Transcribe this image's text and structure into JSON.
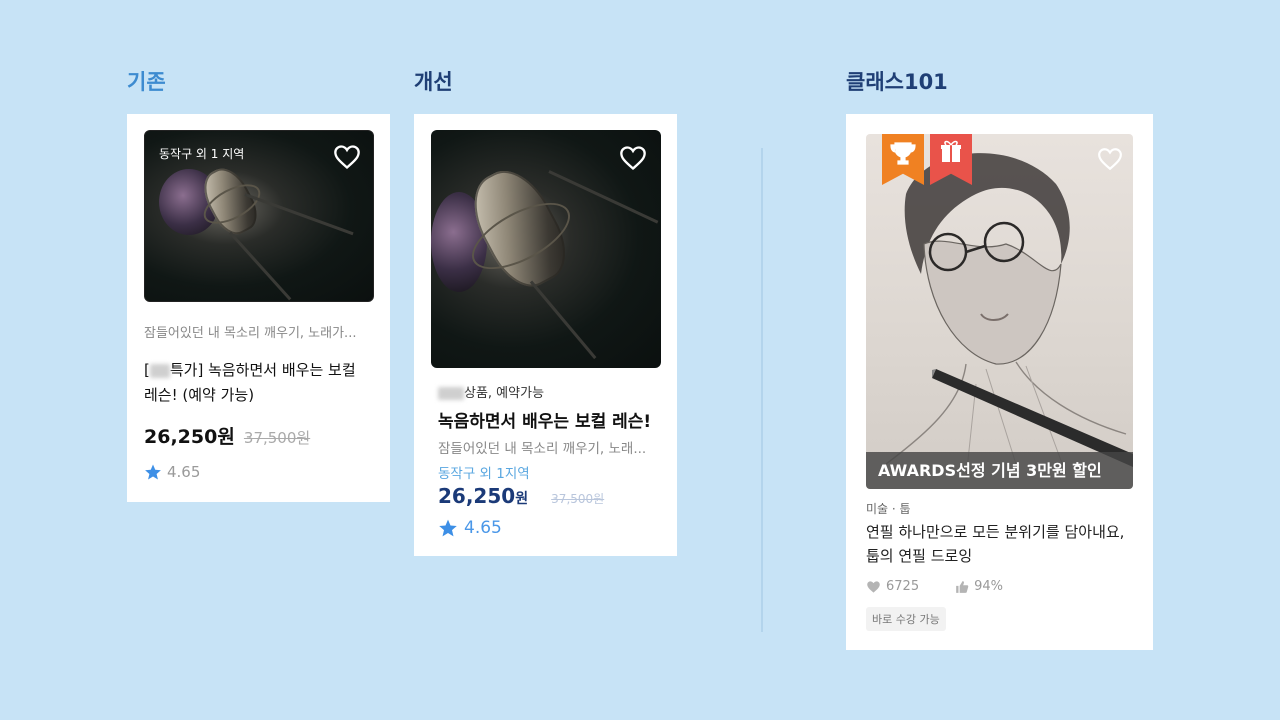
{
  "columns": {
    "before": {
      "title": "기존",
      "title_color": "#3d8bd0",
      "location_tag": "동작구 외 1 지역",
      "subtitle": "잠들어있던 내 목소리 깨우기, 노래가...",
      "title_prefix": "[",
      "title_suffix": "특가] 녹음하면서 배우는 보컬 레슨! (예약 가능)",
      "price": "26,250원",
      "original_price": "37,500원",
      "rating": "4.65",
      "icons": {
        "favorite": "heart-outline-icon",
        "rating": "star-icon"
      }
    },
    "after": {
      "title": "개선",
      "title_color": "#1f3f75",
      "category_suffix": "상품, 예약가능",
      "title_text": "녹음하면서 배우는 보컬 레슨!",
      "subtitle": "잠들어있던 내 목소리 깨우기, 노래...",
      "location": "동작구 외 1지역",
      "location_color": "#5aa7e0",
      "price": "26,250",
      "price_unit": "원",
      "price_color": "#1b3a78",
      "original_price": "37,500원",
      "rating": "4.65",
      "rating_color": "#4a97e8"
    },
    "class101": {
      "title": "클래스101",
      "title_color": "#1f3f75",
      "banner": "AWARDS선정 기념 3만원 할인",
      "category": "미술 · 툽",
      "title_line1": "연필 하나만으로 모든 분위기를 담아내요,",
      "title_line2": "툽의 연필 드로잉",
      "likes": "6725",
      "satisfaction": "94%",
      "badge": "바로 수강 가능",
      "ribbon_colors": {
        "trophy": "#f08122",
        "gift": "#e9534a"
      },
      "icons": {
        "trophy": "trophy-icon",
        "gift": "gift-icon",
        "favorite": "heart-outline-icon",
        "likes": "heart-filled-icon",
        "satisfaction": "thumbs-up-icon"
      }
    }
  }
}
